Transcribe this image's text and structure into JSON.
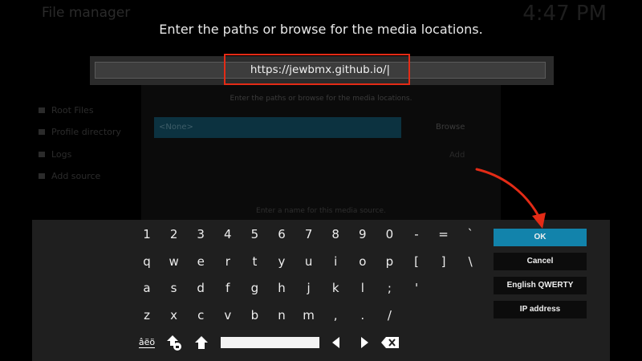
{
  "background": {
    "title": "File manager",
    "clock": "4:47 PM",
    "side_items": [
      "Root Files",
      "Profile directory",
      "Logs",
      "Add source"
    ],
    "panel_subtitle": "Enter the paths or browse for the media locations.",
    "none_label": "<None>",
    "browse_label": "Browse",
    "add_label": "Add",
    "footer_text": "Enter a name for this media source."
  },
  "dialog": {
    "heading": "Enter the paths or browse for the media locations.",
    "input_value": "https://jewbmx.github.io/|"
  },
  "keyboard": {
    "row1": [
      "1",
      "2",
      "3",
      "4",
      "5",
      "6",
      "7",
      "8",
      "9",
      "0",
      "-",
      "=",
      "`"
    ],
    "row2": [
      "q",
      "w",
      "e",
      "r",
      "t",
      "y",
      "u",
      "i",
      "o",
      "p",
      "[",
      "]",
      "\\"
    ],
    "row3": [
      "a",
      "s",
      "d",
      "f",
      "g",
      "h",
      "j",
      "k",
      "l",
      ";",
      "'"
    ],
    "row4": [
      "z",
      "x",
      "c",
      "v",
      "b",
      "n",
      "m",
      ",",
      ".",
      "/"
    ],
    "symbols_label": "âëö",
    "ok_label": "OK",
    "cancel_label": "Cancel",
    "layout_label": "English QWERTY",
    "ip_label": "IP address"
  },
  "colors": {
    "accent": "#1283ab",
    "annotation": "#e32b16"
  }
}
